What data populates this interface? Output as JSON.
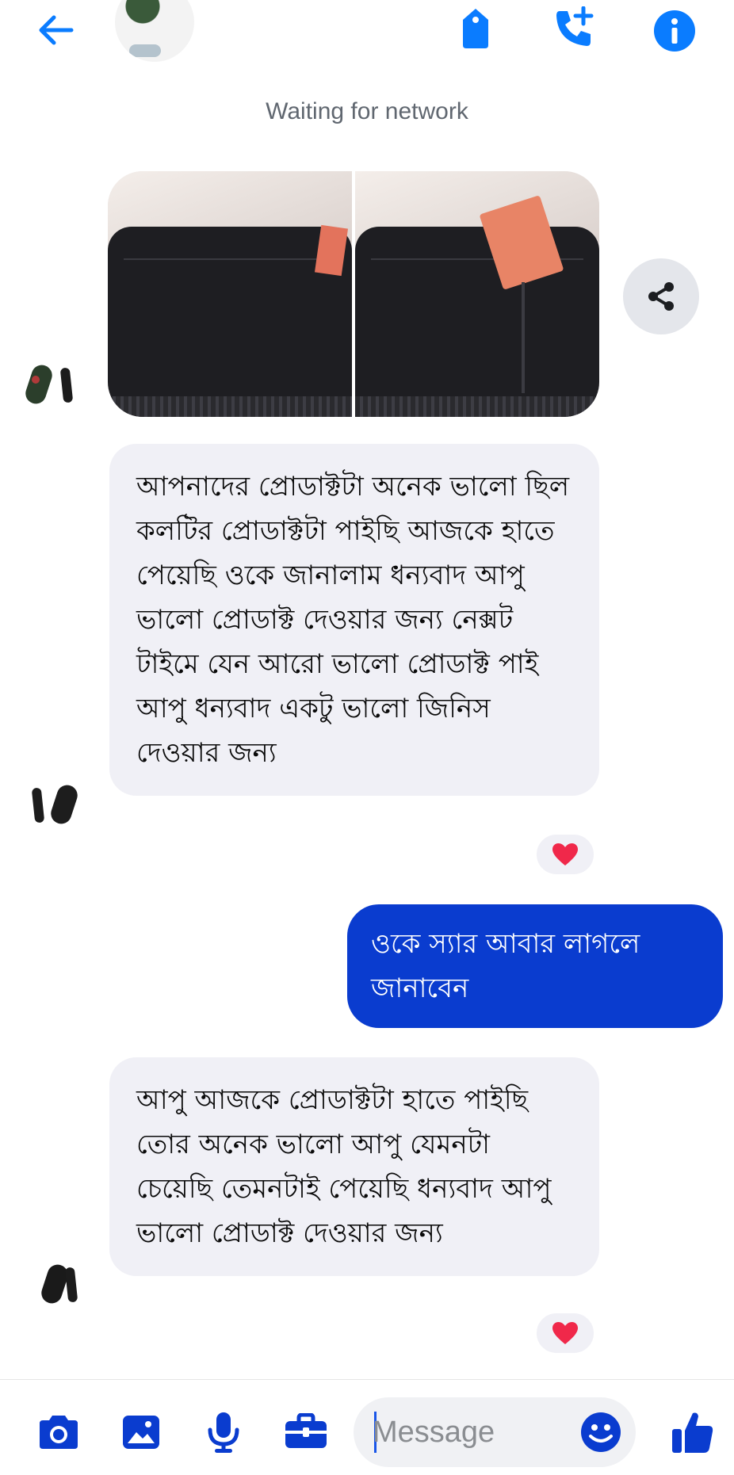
{
  "header": {
    "status": "Waiting for network"
  },
  "messages": [
    {
      "type": "incoming",
      "text": "আপনাদের প্রোডাক্টটা অনেক ভালো ছিল কলটির প্রোডাক্টটা পাইছি আজকে হাতে পেয়েছি ওকে জানালাম ধন্যবাদ আপু ভালো প্রোডাক্ট দেওয়ার জন্য নেক্সট টাইমে যেন আরো ভালো প্রোডাক্ট পাই আপু ধন্যবাদ একটু ভালো জিনিস দেওয়ার জন্য",
      "reaction": "❤️"
    },
    {
      "type": "outgoing",
      "text": "ওকে স্যার আবার লাগলে জানাবেন"
    },
    {
      "type": "incoming",
      "text": "আপু আজকে প্রোডাক্টটা হাতে পাইছি তোর অনেক ভালো আপু যেমনটা চেয়েছি তেমনটাই পেয়েছি ধন্যবাদ আপু ভালো প্রোডাক্ট দেওয়ার জন্য",
      "reaction": "❤️"
    }
  ],
  "composer": {
    "placeholder": "Message"
  },
  "colors": {
    "accent": "#0a7cff",
    "outgoing_bubble": "#0a3ccf",
    "incoming_bubble": "#f0f0f6"
  }
}
